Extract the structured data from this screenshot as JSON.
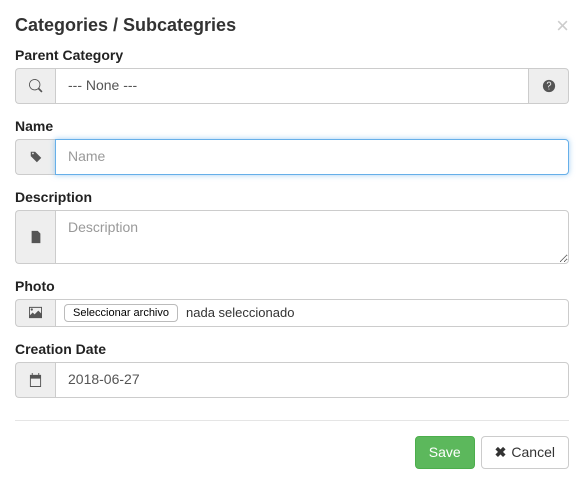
{
  "header": {
    "title": "Categories / Subcategries"
  },
  "fields": {
    "parent": {
      "label": "Parent Category",
      "value": "--- None ---"
    },
    "name": {
      "label": "Name",
      "placeholder": "Name",
      "value": ""
    },
    "description": {
      "label": "Description",
      "placeholder": "Description",
      "value": ""
    },
    "photo": {
      "label": "Photo",
      "button": "Seleccionar archivo",
      "status": "nada seleccionado"
    },
    "creation_date": {
      "label": "Creation Date",
      "value": "2018-06-27"
    }
  },
  "footer": {
    "save": "Save",
    "cancel": "Cancel"
  }
}
